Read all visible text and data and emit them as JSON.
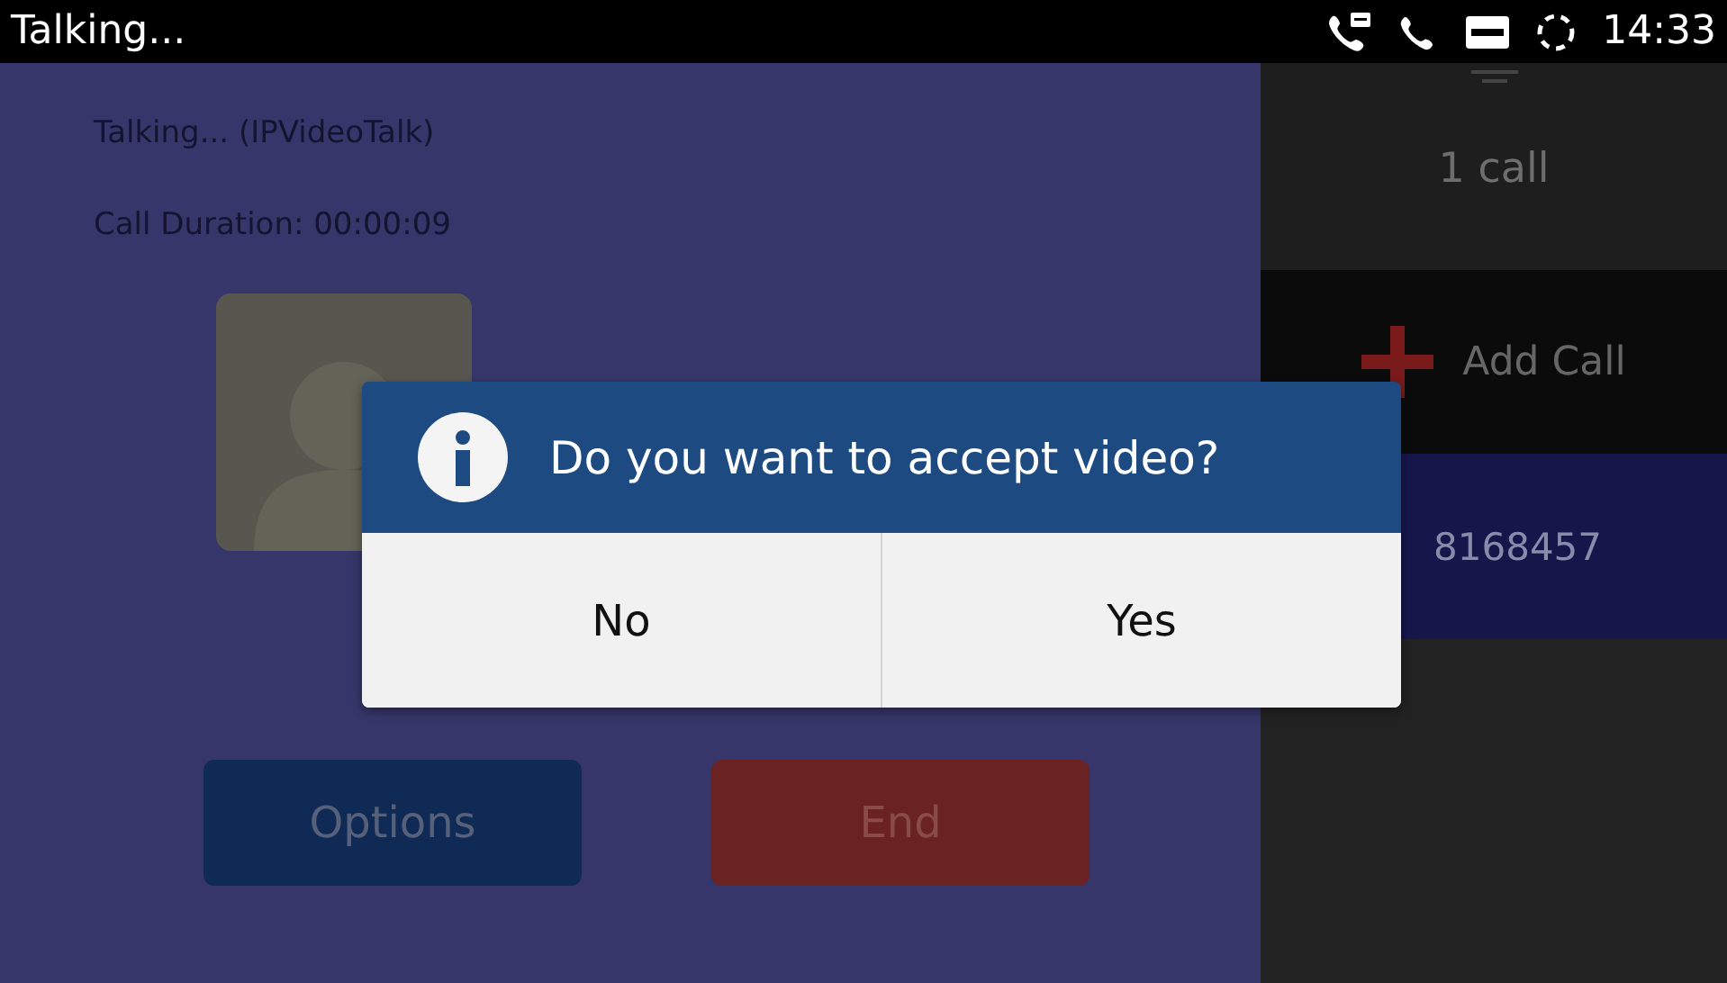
{
  "status_bar": {
    "title": "Talking...",
    "time": "14:33"
  },
  "call_info": {
    "status": "Talking... (IPVideoTalk)",
    "duration": "Call Duration: 00:00:09"
  },
  "call_buttons": [
    {
      "label": "Options",
      "kind": "options"
    },
    {
      "label": "End",
      "kind": "end"
    }
  ],
  "sidebar": {
    "count": "1 call",
    "add_call": "Add Call",
    "calls": [
      {
        "number": "8168457",
        "selected": true
      }
    ]
  },
  "dialog": {
    "message": "Do you want to accept video?",
    "buttons": [
      "No",
      "Yes"
    ]
  }
}
